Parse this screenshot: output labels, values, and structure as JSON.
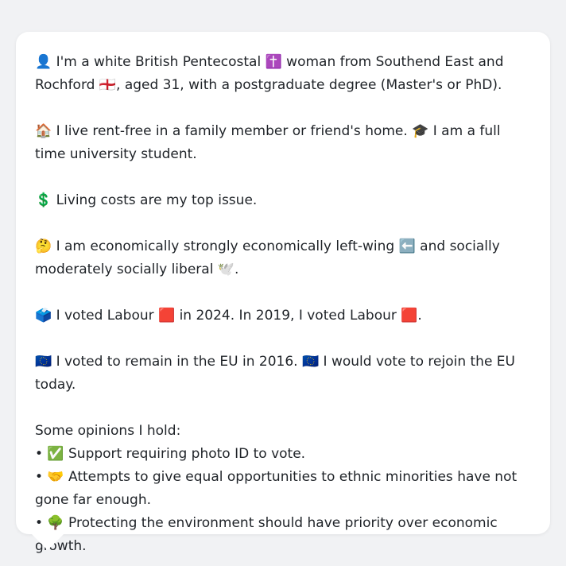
{
  "profile": {
    "identity": "👤 I'm a white British Pentecostal ✝️ woman from Southend East and Rochford 🏴󠁧󠁢󠁥󠁮󠁧󠁿, aged 31, with a postgraduate degree (Master's or PhD).",
    "living": "🏠 I live rent-free in a family member or friend's home. 🎓 I am a full time university student.",
    "top_issue": "💲 Living costs are my top issue.",
    "ideology": "🤔 I am economically strongly economically left-wing ⬅️ and socially moderately socially liberal 🕊️.",
    "voting": "🗳️ I voted Labour 🟥 in 2024. In 2019, I voted Labour 🟥.",
    "eu": "🇪🇺 I voted to remain in the EU in 2016. 🇪🇺 I would vote to rejoin the EU today.",
    "opinions_heading": "Some opinions I hold:",
    "opinions": [
      "• ✅ Support requiring photo ID to vote.",
      "• 🤝 Attempts to give equal opportunities to ethnic minorities have not gone far enough.",
      "• 🌳 Protecting the environment should have priority over economic growth."
    ]
  }
}
